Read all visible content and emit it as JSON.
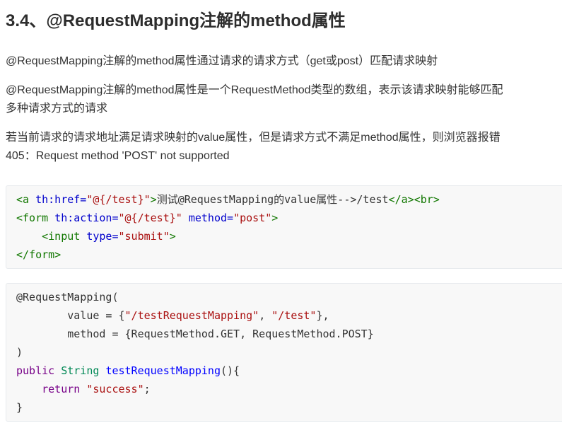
{
  "page": {
    "title": "3.4、@RequestMapping注解的method属性",
    "paragraphs": [
      {
        "lines": [
          "@RequestMapping注解的method属性通过请求的请求方式（get或post）匹配请求映射"
        ]
      },
      {
        "lines": [
          "@RequestMapping注解的method属性是一个RequestMethod类型的数组，表示该请求映射能够匹配",
          "多种请求方式的请求"
        ]
      },
      {
        "lines": [
          "若当前请求的请求地址满足请求映射的value属性，但是请求方式不满足method属性，则浏览器报错",
          "405：Request method 'POST' not supported"
        ]
      }
    ]
  },
  "colors": {
    "pln": "#333333",
    "tag": "#117700",
    "attr": "#0000cc",
    "str": "#aa1111",
    "kw": "#770088",
    "type": "#008855",
    "def": "#0000ff",
    "heading": "#2d2d2d",
    "body_text": "#333333"
  },
  "code_style": {
    "background": "#f8f8f8",
    "border": "#e7eaed"
  },
  "code_blocks": [
    {
      "lines": [
        [
          {
            "t": "<a",
            "c": "tag"
          },
          {
            "t": " ",
            "c": "pln"
          },
          {
            "t": "th:href=",
            "c": "attr"
          },
          {
            "t": "\"@{/test}\"",
            "c": "str"
          },
          {
            "t": ">",
            "c": "tag"
          },
          {
            "t": "测试@RequestMapping的value属性-->/test",
            "c": "pln"
          },
          {
            "t": "</a>",
            "c": "tag"
          },
          {
            "t": "<br>",
            "c": "tag"
          }
        ],
        [
          {
            "t": "<form",
            "c": "tag"
          },
          {
            "t": " ",
            "c": "pln"
          },
          {
            "t": "th:action=",
            "c": "attr"
          },
          {
            "t": "\"@{/test}\"",
            "c": "str"
          },
          {
            "t": " ",
            "c": "pln"
          },
          {
            "t": "method=",
            "c": "attr"
          },
          {
            "t": "\"post\"",
            "c": "str"
          },
          {
            "t": ">",
            "c": "tag"
          }
        ],
        [
          {
            "t": "    ",
            "c": "pln"
          },
          {
            "t": "<input",
            "c": "tag"
          },
          {
            "t": " ",
            "c": "pln"
          },
          {
            "t": "type=",
            "c": "attr"
          },
          {
            "t": "\"submit\"",
            "c": "str"
          },
          {
            "t": ">",
            "c": "tag"
          }
        ],
        [
          {
            "t": "</form>",
            "c": "tag"
          }
        ]
      ]
    },
    {
      "lines": [
        [
          {
            "t": "@RequestMapping(",
            "c": "pln"
          }
        ],
        [
          {
            "t": "        value = {",
            "c": "pln"
          },
          {
            "t": "\"/testRequestMapping\"",
            "c": "str"
          },
          {
            "t": ", ",
            "c": "pln"
          },
          {
            "t": "\"/test\"",
            "c": "str"
          },
          {
            "t": "},",
            "c": "pln"
          }
        ],
        [
          {
            "t": "        method = {RequestMethod.GET, RequestMethod.POST}",
            "c": "pln"
          }
        ],
        [
          {
            "t": ")",
            "c": "pln"
          }
        ],
        [
          {
            "t": "public",
            "c": "kw"
          },
          {
            "t": " ",
            "c": "pln"
          },
          {
            "t": "String",
            "c": "type"
          },
          {
            "t": " ",
            "c": "pln"
          },
          {
            "t": "testRequestMapping",
            "c": "def"
          },
          {
            "t": "(){",
            "c": "pln"
          }
        ],
        [
          {
            "t": "    ",
            "c": "pln"
          },
          {
            "t": "return",
            "c": "kw"
          },
          {
            "t": " ",
            "c": "pln"
          },
          {
            "t": "\"success\"",
            "c": "str"
          },
          {
            "t": ";",
            "c": "pln"
          }
        ],
        [
          {
            "t": "}",
            "c": "pln"
          }
        ]
      ]
    }
  ]
}
